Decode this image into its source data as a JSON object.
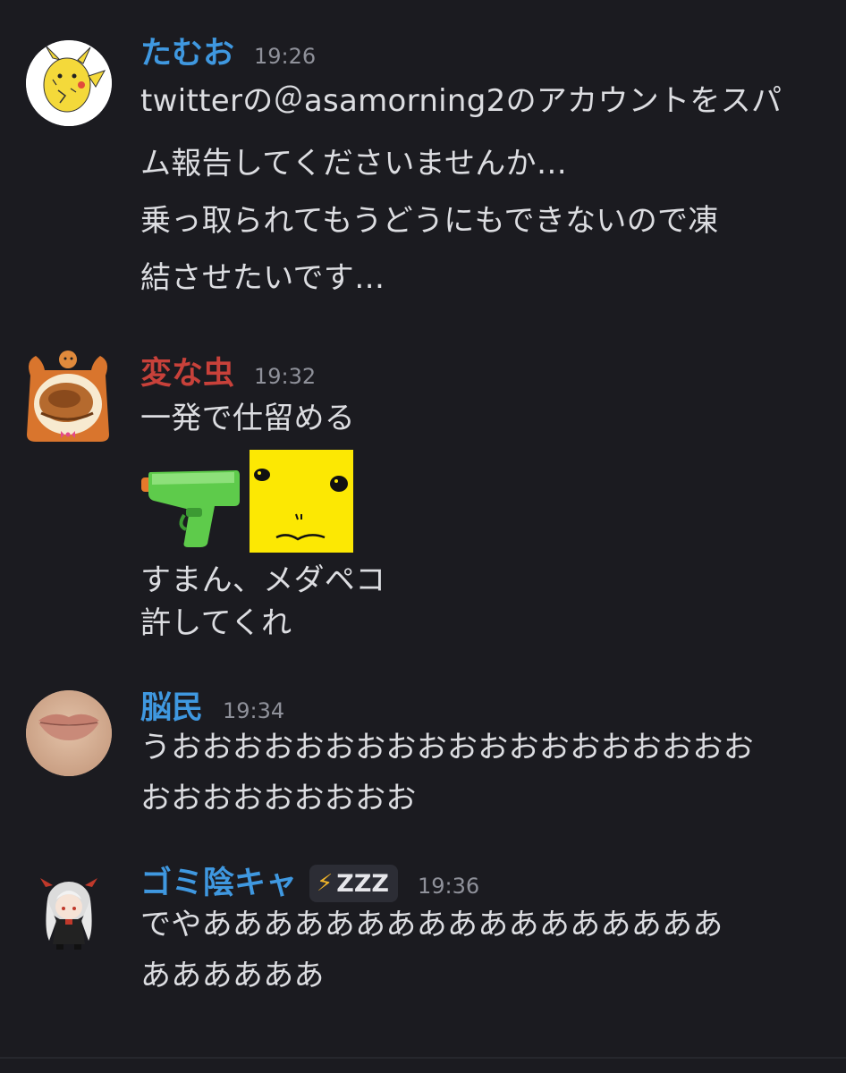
{
  "colors": {
    "background": "#1b1b20",
    "message_text": "#dcdde1",
    "timestamp": "#8f919a",
    "username_blue": "#3f98e0",
    "username_red": "#c8413a"
  },
  "messages": [
    {
      "username": "たむお",
      "username_color": "#3f98e0",
      "timestamp": "19:26",
      "avatar_icon": "pikachu-drawing-avatar",
      "lines": [
        "twitterの＠asamorning2のアカウントをスパ",
        "ム報告してくださいませんか…",
        "乗っ取られてもうどうにもできないので凍",
        "結させたいです…"
      ]
    },
    {
      "username": "変な虫",
      "username_color": "#c8413a",
      "timestamp": "19:32",
      "avatar_icon": "dog-bread-frame-avatar",
      "lines": [
        "一発で仕留める"
      ],
      "emojis": [
        "water-pistol-emoji",
        "yellow-face-custom-emoji"
      ],
      "lines_after": [
        "すまん、メダペコ",
        "許してくれ"
      ]
    },
    {
      "username": "脳民",
      "username_color": "#3f98e0",
      "timestamp": "19:34",
      "avatar_icon": "lips-avatar",
      "lines": [
        "うおおおおおおおおおおおおおおおおおおお",
        "おおおおおおおおお"
      ]
    },
    {
      "username": "ゴミ陰キャ",
      "username_color": "#3f98e0",
      "timestamp": "19:36",
      "avatar_icon": "anime-chibi-avatar",
      "status_badge": "ZZZ",
      "status_icon": "lightning-icon",
      "lines": [
        "でやあああああああああああああああああ",
        "ああああああ"
      ]
    }
  ]
}
